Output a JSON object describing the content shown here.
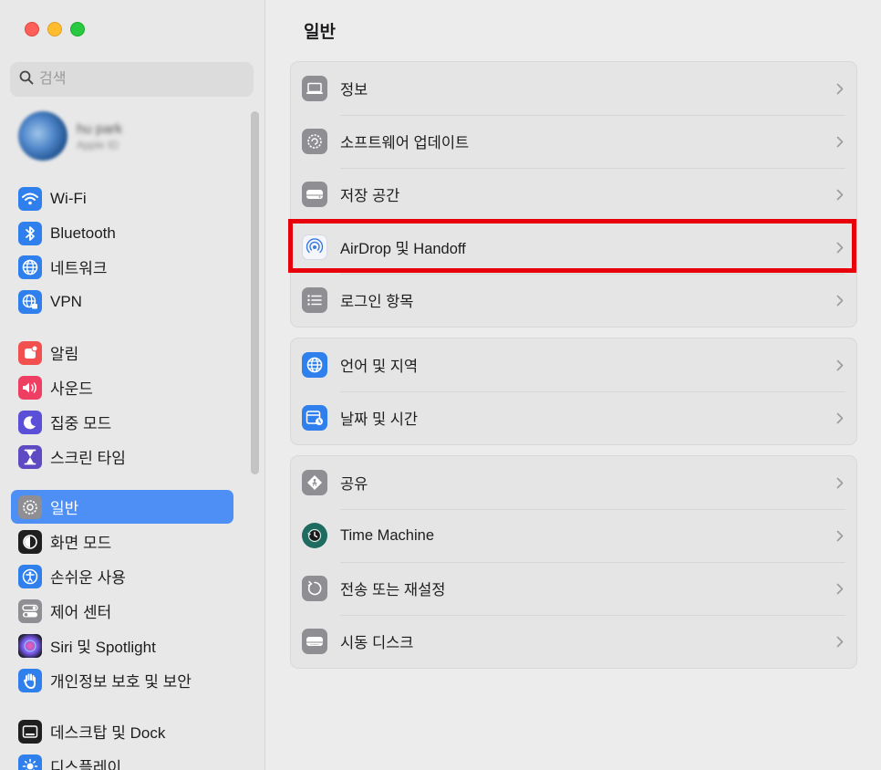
{
  "window": {
    "title": "일반"
  },
  "search": {
    "placeholder": "검색"
  },
  "profile": {
    "name": "hu park",
    "subtitle": "Apple ID"
  },
  "sidebar": {
    "items": [
      {
        "label": "Wi-Fi",
        "icon": "wifi-icon"
      },
      {
        "label": "Bluetooth",
        "icon": "bluetooth-icon"
      },
      {
        "label": "네트워크",
        "icon": "globe-icon"
      },
      {
        "label": "VPN",
        "icon": "vpn-icon"
      },
      {
        "label": "알림",
        "icon": "bell-icon"
      },
      {
        "label": "사운드",
        "icon": "speaker-icon"
      },
      {
        "label": "집중 모드",
        "icon": "moon-icon"
      },
      {
        "label": "스크린 타임",
        "icon": "hourglass-icon"
      },
      {
        "label": "일반",
        "icon": "gear-icon",
        "selected": true
      },
      {
        "label": "화면 모드",
        "icon": "appearance-icon"
      },
      {
        "label": "손쉬운 사용",
        "icon": "accessibility-icon"
      },
      {
        "label": "제어 센터",
        "icon": "control-center-icon"
      },
      {
        "label": "Siri 및 Spotlight",
        "icon": "siri-icon"
      },
      {
        "label": "개인정보 보호 및 보안",
        "icon": "hand-icon"
      },
      {
        "label": "데스크탑 및 Dock",
        "icon": "dock-icon"
      },
      {
        "label": "디스플레이",
        "icon": "display-icon"
      }
    ]
  },
  "main": {
    "title": "일반",
    "groups": [
      {
        "rows": [
          {
            "label": "정보",
            "icon": "laptop-icon"
          },
          {
            "label": "소프트웨어 업데이트",
            "icon": "gear-update-icon"
          },
          {
            "label": "저장 공간",
            "icon": "drive-icon"
          },
          {
            "label": "AirDrop 및 Handoff",
            "icon": "airdrop-icon",
            "highlighted": true
          },
          {
            "label": "로그인 항목",
            "icon": "list-icon"
          }
        ]
      },
      {
        "rows": [
          {
            "label": "언어 및 지역",
            "icon": "globe-icon"
          },
          {
            "label": "날짜 및 시간",
            "icon": "calendar-clock-icon"
          }
        ]
      },
      {
        "rows": [
          {
            "label": "공유",
            "icon": "sharing-icon"
          },
          {
            "label": "Time Machine",
            "icon": "time-machine-icon"
          },
          {
            "label": "전송 또는 재설정",
            "icon": "reset-icon"
          },
          {
            "label": "시동 디스크",
            "icon": "startup-disk-icon"
          }
        ]
      }
    ]
  },
  "colors": {
    "accent": "#4d8ff5",
    "highlight_box": "#e8000b"
  }
}
